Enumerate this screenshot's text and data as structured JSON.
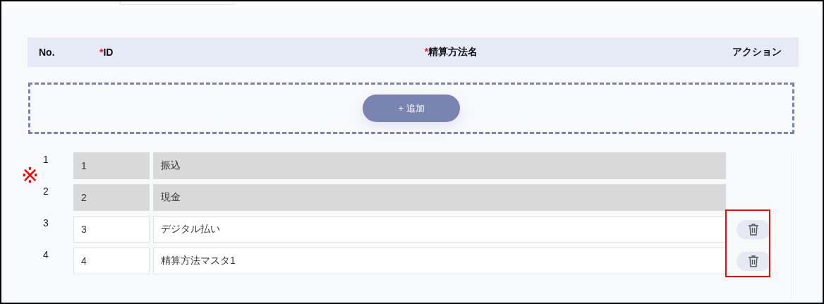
{
  "table": {
    "columns": [
      {
        "label": "No."
      },
      {
        "label": "ID",
        "required_mark": "*"
      },
      {
        "label": "精算方法名",
        "required_mark": "*"
      },
      {
        "label": "アクション"
      }
    ],
    "add_button": "+ 追加",
    "rows": [
      {
        "no": "1",
        "id": "1",
        "name": "振込",
        "disabled": true
      },
      {
        "no": "2",
        "id": "2",
        "name": "現金",
        "disabled": true
      },
      {
        "no": "3",
        "id": "3",
        "name": "デジタル払い",
        "disabled": false
      },
      {
        "no": "4",
        "id": "4",
        "name": "精算方法マスタ1",
        "disabled": false
      }
    ]
  },
  "annotations": {
    "note_mark": "※",
    "highlight_actions": true
  }
}
